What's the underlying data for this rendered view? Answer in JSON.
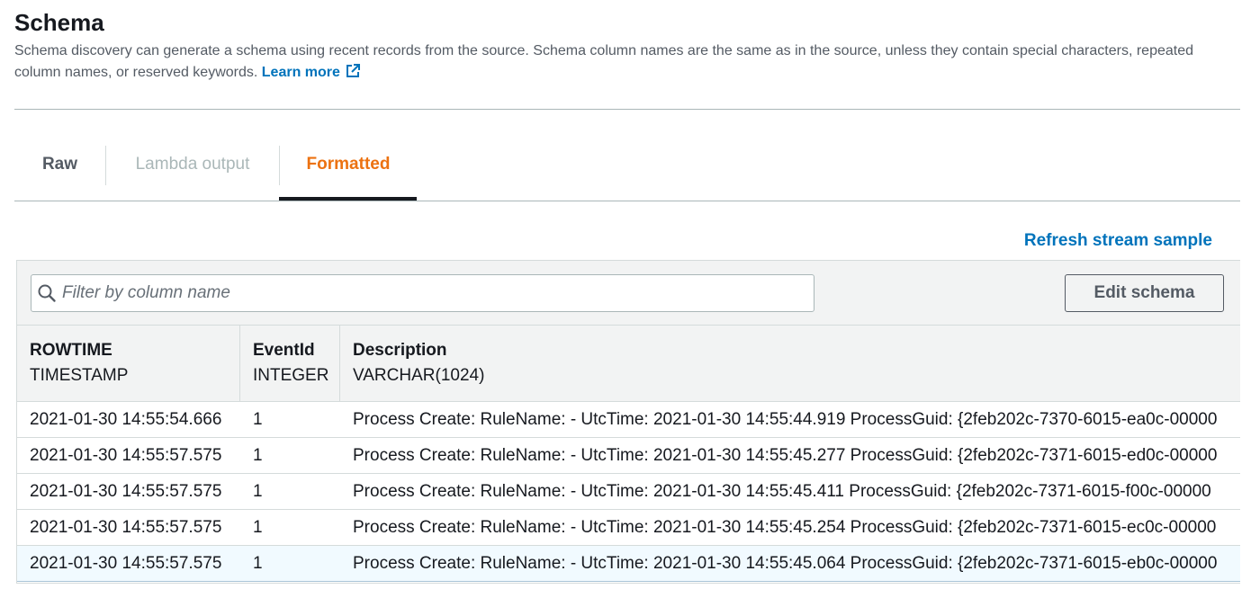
{
  "header": {
    "title": "Schema",
    "description": "Schema discovery can generate a schema using recent records from the source. Schema column names are the same as in the source, unless they contain special characters, repeated column names, or reserved keywords.",
    "learn_more": "Learn more"
  },
  "tabs": [
    {
      "label": "Raw",
      "state": "enabled"
    },
    {
      "label": "Lambda output",
      "state": "disabled"
    },
    {
      "label": "Formatted",
      "state": "active"
    }
  ],
  "refresh_label": "Refresh stream sample",
  "filter": {
    "placeholder": "Filter by column name",
    "value": ""
  },
  "edit_schema_label": "Edit schema",
  "columns": [
    {
      "name": "ROWTIME",
      "type": "TIMESTAMP"
    },
    {
      "name": "EventId",
      "type": "INTEGER"
    },
    {
      "name": "Description",
      "type": "VARCHAR(1024)"
    }
  ],
  "rows": [
    [
      "2021-01-30 14:55:54.666",
      "1",
      "Process Create: RuleName: - UtcTime: 2021-01-30 14:55:44.919 ProcessGuid: {2feb202c-7370-6015-ea0c-00000"
    ],
    [
      "2021-01-30 14:55:57.575",
      "1",
      "Process Create: RuleName: - UtcTime: 2021-01-30 14:55:45.277 ProcessGuid: {2feb202c-7371-6015-ed0c-00000"
    ],
    [
      "2021-01-30 14:55:57.575",
      "1",
      "Process Create: RuleName: - UtcTime: 2021-01-30 14:55:45.411 ProcessGuid: {2feb202c-7371-6015-f00c-00000"
    ],
    [
      "2021-01-30 14:55:57.575",
      "1",
      "Process Create: RuleName: - UtcTime: 2021-01-30 14:55:45.254 ProcessGuid: {2feb202c-7371-6015-ec0c-00000"
    ],
    [
      "2021-01-30 14:55:57.575",
      "1",
      "Process Create: RuleName: - UtcTime: 2021-01-30 14:55:45.064 ProcessGuid: {2feb202c-7371-6015-eb0c-00000"
    ]
  ],
  "colors": {
    "link": "#0073bb",
    "active_tab": "#ec7211",
    "disabled_tab": "#aab7b8",
    "highlight_row": "#f1faff"
  },
  "icons": {
    "learn_more": "external-link-icon",
    "filter": "search-icon"
  }
}
